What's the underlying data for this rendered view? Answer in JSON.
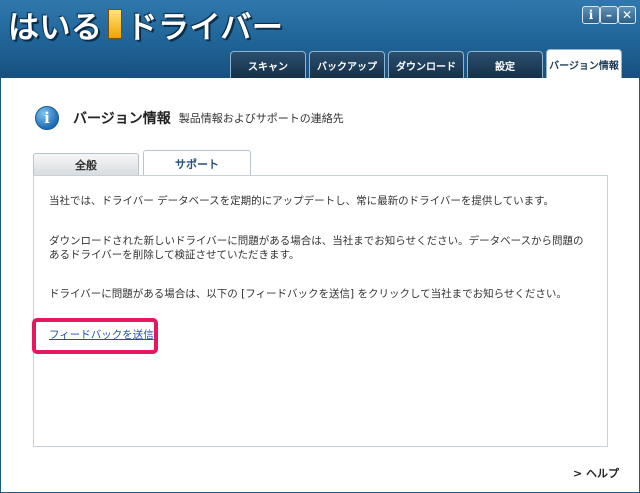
{
  "app": {
    "logo_part1": "はいる",
    "logo_part2": "ドライバー"
  },
  "window_controls": {
    "info": "i",
    "minimize": "–",
    "close": "✕"
  },
  "main_tabs": [
    {
      "label": "スキャン",
      "active": false
    },
    {
      "label": "バックアップ",
      "active": false
    },
    {
      "label": "ダウンロード",
      "active": false
    },
    {
      "label": "設定",
      "active": false
    },
    {
      "label": "バージョン情報",
      "active": true
    }
  ],
  "header": {
    "icon": "info-icon",
    "title": "バージョン情報",
    "subtitle": "製品情報およびサポートの連絡先"
  },
  "sub_tabs": [
    {
      "label": "全般",
      "active": false
    },
    {
      "label": "サポート",
      "active": true
    }
  ],
  "support": {
    "paragraph1": "当社では、ドライバー データベースを定期的にアップデートし、常に最新のドライバーを提供しています。",
    "paragraph2": "ダウンロードされた新しいドライバーに問題がある場合は、当社までお知らせください。データベースから問題のあるドライバーを削除して検証させていただきます。",
    "paragraph3": "ドライバーに問題がある場合は、以下の [フィードバックを送信] をクリックして当社までお知らせください。",
    "feedback_link": "フィードバックを送信"
  },
  "footer": {
    "help": "> ヘルプ"
  },
  "colors": {
    "titlebar": "#1f6396",
    "highlight": "#e8175d",
    "link": "#1f4fb0"
  }
}
